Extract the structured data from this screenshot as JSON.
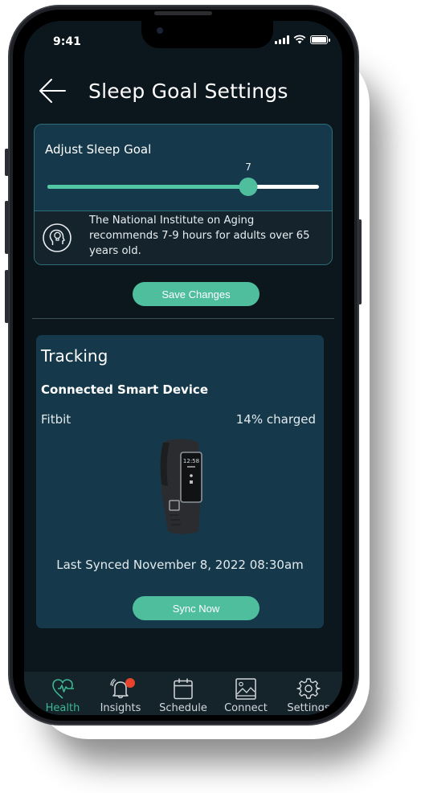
{
  "status_bar": {
    "time": "9:41",
    "icons": [
      "cellular-signal-icon",
      "wifi-icon",
      "battery-icon"
    ]
  },
  "header": {
    "back_icon": "arrow-left-icon",
    "title": "Sleep Goal Settings"
  },
  "sleep_goal": {
    "label": "Adjust Sleep Goal",
    "slider_value": "7",
    "slider_fill_fraction": 0.74,
    "info_icon": "head-lightbulb-icon",
    "info_text": "The National Institute on Aging recommends 7-9 hours for adults over 65 years old.",
    "save_label": "Save Changes"
  },
  "tracking": {
    "title": "Tracking",
    "device_heading": "Connected Smart Device",
    "device_name": "Fitbit",
    "device_battery": "14% charged",
    "device_image": "fitbit-watch-image",
    "watch_time": "12:58",
    "last_synced": "Last Synced November 8, 2022 08:30am",
    "sync_label": "Sync Now"
  },
  "tabbar": {
    "tabs": [
      {
        "label": "Health",
        "icon": "heart-pulse-icon",
        "active": true
      },
      {
        "label": "Insights",
        "icon": "bell-icon",
        "badge": true
      },
      {
        "label": "Schedule",
        "icon": "calendar-icon"
      },
      {
        "label": "Connect",
        "icon": "image-icon"
      },
      {
        "label": "Settings",
        "icon": "gear-icon"
      }
    ]
  },
  "colors": {
    "accent": "#4fbe9d",
    "background": "#0b161d",
    "card": "#15394b",
    "badge": "#e8432d"
  }
}
